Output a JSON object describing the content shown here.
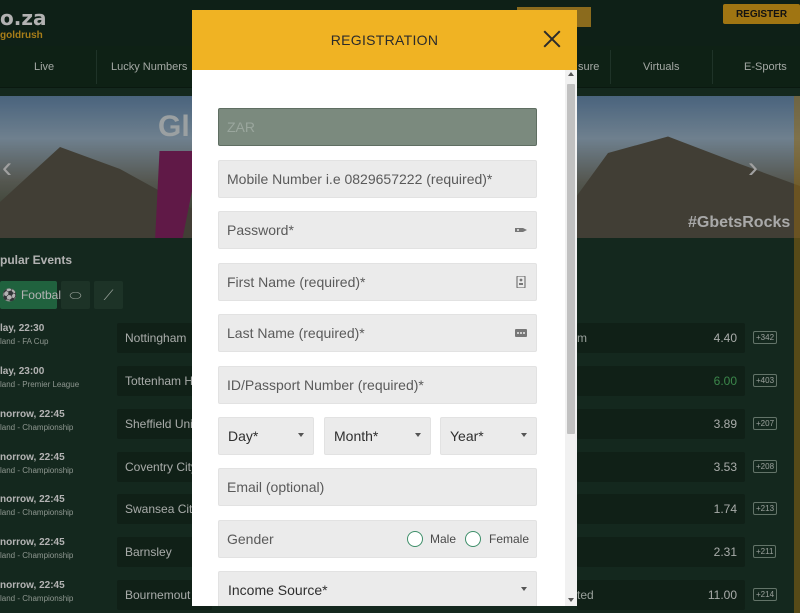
{
  "site": {
    "logo_text": "o.za",
    "logo_sub": "goldrush",
    "register_label": "REGISTER",
    "nav": [
      "Live",
      "Lucky Numbers",
      "sure",
      "Virtuals",
      "E-Sports"
    ],
    "banner_text": "Gl",
    "banner_hashtag": "#GbetsRocks",
    "popular_title": "pular Events",
    "sport_tab": "Football",
    "events": [
      {
        "time": "lay, 22:30",
        "league": "land - FA Cup",
        "team": "Nottingham",
        "odd_team": "m",
        "odd": "4.40",
        "more": "+342",
        "green": false
      },
      {
        "time": "lay, 23:00",
        "league": "land - Premier League",
        "team": "Tottenham H",
        "odd_team": "",
        "odd": "6.00",
        "more": "+403",
        "green": true
      },
      {
        "time": "norrow, 22:45",
        "league": "land - Championship",
        "team": "Sheffield Uni",
        "odd_team": "",
        "odd": "3.89",
        "more": "+207",
        "green": false
      },
      {
        "time": "norrow, 22:45",
        "league": "land - Championship",
        "team": "Coventry City",
        "odd_team": "",
        "odd": "3.53",
        "more": "+208",
        "green": false
      },
      {
        "time": "norrow, 22:45",
        "league": "land - Championship",
        "team": "Swansea Cit",
        "odd_team": "",
        "odd": "1.74",
        "more": "+213",
        "green": false
      },
      {
        "time": "norrow, 22:45",
        "league": "land - Championship",
        "team": "Barnsley",
        "odd_team": "",
        "odd": "2.31",
        "more": "+211",
        "green": false
      },
      {
        "time": "norrow, 22:45",
        "league": "land - Championship",
        "team": "Bournemout",
        "odd_team": "ted",
        "odd": "11.00",
        "more": "+214",
        "green": false
      }
    ]
  },
  "modal": {
    "title": "REGISTRATION",
    "currency": "ZAR",
    "mobile_placeholder": "Mobile Number i.e 0829657222 (required)*",
    "password_placeholder": "Password*",
    "first_name_placeholder": "First Name (required)*",
    "last_name_placeholder": "Last Name (required)*",
    "id_placeholder": "ID/Passport Number (required)*",
    "day_label": "Day*",
    "month_label": "Month*",
    "year_label": "Year*",
    "email_placeholder": "Email (optional)",
    "gender_label": "Gender",
    "male_label": "Male",
    "female_label": "Female",
    "income_label": "Income Source*"
  },
  "colors": {
    "header_yellow": "#f0b323",
    "site_green": "#1e3a2c",
    "radio_green": "#3f8f6a"
  }
}
